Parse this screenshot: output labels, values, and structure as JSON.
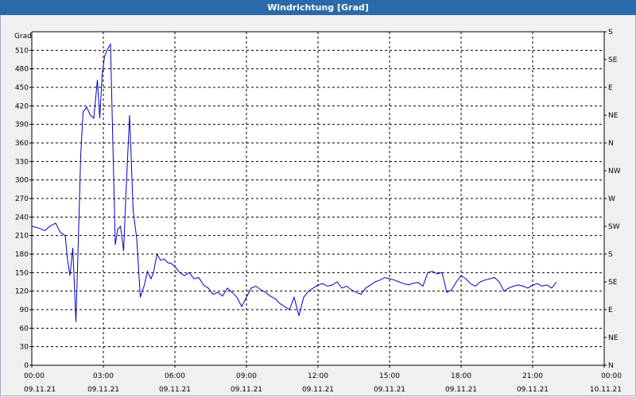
{
  "window": {
    "title": "Windrichtung [Grad]"
  },
  "chart_data": {
    "type": "line",
    "ylabel": "Grad",
    "ylim": [
      0,
      540
    ],
    "yticks": [
      0,
      30,
      60,
      90,
      120,
      150,
      180,
      210,
      240,
      270,
      300,
      330,
      360,
      390,
      420,
      450,
      480,
      510
    ],
    "right_axis_labels": [
      "N",
      "NE",
      "E",
      "SE",
      "S",
      "SW",
      "W",
      "NW",
      "N",
      "NE",
      "E",
      "SE",
      "S"
    ],
    "x_ticks": [
      {
        "time": "00:00",
        "date": "09.11.21"
      },
      {
        "time": "03:00",
        "date": "09.11.21"
      },
      {
        "time": "06:00",
        "date": "09.11.21"
      },
      {
        "time": "09:00",
        "date": "09.11.21"
      },
      {
        "time": "12:00",
        "date": "09.11.21"
      },
      {
        "time": "15:00",
        "date": "09.11.21"
      },
      {
        "time": "18:00",
        "date": "09.11.21"
      },
      {
        "time": "21:00",
        "date": "09.11.21"
      },
      {
        "time": "00:00",
        "date": "10.11.21"
      }
    ],
    "grid": true,
    "line_color": "#0000c0",
    "series": [
      {
        "x_hours": [
          0.0,
          0.3,
          0.55,
          0.75,
          1.0,
          1.2,
          1.4,
          1.5,
          1.6,
          1.72,
          1.85,
          1.95,
          2.05,
          2.15,
          2.3,
          2.45,
          2.6,
          2.75,
          2.85,
          2.95,
          3.05,
          3.15,
          3.3,
          3.5,
          3.6,
          3.72,
          3.85,
          3.95,
          4.1,
          4.25,
          4.4,
          4.55,
          4.72,
          4.85,
          5.0,
          5.1,
          5.25,
          5.4,
          5.55,
          5.7,
          5.85,
          6.0,
          6.2,
          6.4,
          6.6,
          6.8,
          7.0,
          7.2,
          7.4,
          7.6,
          7.8,
          8.0,
          8.2,
          8.4,
          8.6,
          8.8,
          9.0,
          9.2,
          9.4,
          9.6,
          9.8,
          10.0,
          10.2,
          10.4,
          10.6,
          10.8,
          11.0,
          11.2,
          11.4,
          11.6,
          11.8,
          12.0,
          12.2,
          12.4,
          12.6,
          12.8,
          13.0,
          13.2,
          13.4,
          13.6,
          13.8,
          14.0,
          14.2,
          14.4,
          14.6,
          14.8,
          15.0,
          15.2,
          15.4,
          15.6,
          15.8,
          16.0,
          16.2,
          16.4,
          16.6,
          16.8,
          17.0,
          17.2,
          17.4,
          17.6,
          17.8,
          18.0,
          18.2,
          18.4,
          18.6,
          18.8,
          19.0,
          19.2,
          19.4,
          19.6,
          19.8,
          20.0,
          20.2,
          20.4,
          20.6,
          20.8,
          21.0,
          21.2,
          21.4,
          21.6,
          21.8,
          22.0,
          22.2,
          22.4,
          22.6,
          22.8,
          23.0,
          23.2,
          23.4,
          23.6,
          23.8,
          24.0
        ],
        "values": [
          225,
          222,
          218,
          225,
          230,
          215,
          210,
          170,
          145,
          190,
          70,
          200,
          340,
          410,
          418,
          405,
          400,
          462,
          400,
          470,
          500,
          510,
          520,
          195,
          220,
          225,
          185,
          280,
          405,
          250,
          205,
          110,
          130,
          152,
          140,
          150,
          180,
          170,
          172,
          166,
          165,
          160,
          150,
          145,
          150,
          140,
          142,
          130,
          125,
          115,
          118,
          112,
          125,
          118,
          110,
          95,
          110,
          125,
          128,
          122,
          118,
          112,
          108,
          100,
          95,
          90,
          110,
          80,
          110,
          120,
          125,
          130,
          132,
          128,
          130,
          135,
          125,
          128,
          122,
          118,
          115,
          125,
          130,
          135,
          138,
          142,
          140,
          138,
          135,
          132,
          130,
          133,
          134,
          128,
          150,
          152,
          148,
          150,
          118,
          122,
          135,
          145,
          140,
          132,
          128,
          135,
          138,
          140,
          142,
          135,
          120,
          125,
          128,
          130,
          128,
          125,
          130,
          132,
          128,
          130,
          125,
          135
        ]
      }
    ]
  }
}
